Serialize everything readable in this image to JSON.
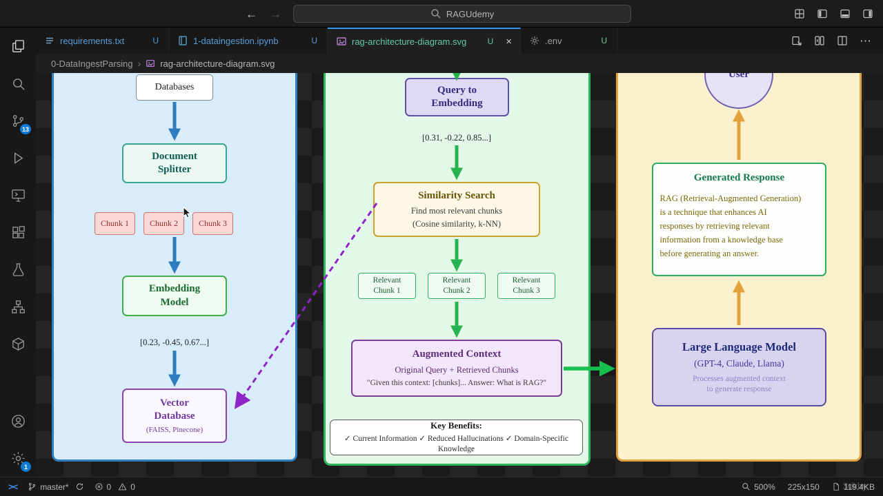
{
  "titlebar": {
    "search_text": "RAGUdemy"
  },
  "icons": {
    "back_arrow": "←",
    "forward_arrow": "→",
    "close": "×",
    "breadcrumb_chevron": "›",
    "more_actions": "⋯",
    "remote": "><"
  },
  "tabs": [
    {
      "label": "requirements.txt",
      "git": "U"
    },
    {
      "label": "1-dataingestion.ipynb",
      "git": "U"
    },
    {
      "label": "rag-architecture-diagram.svg",
      "git": "U"
    },
    {
      "label": ".env",
      "git": "U"
    }
  ],
  "breadcrumb": {
    "folder": "0-DataIngestParsing",
    "file": "rag-architecture-diagram.svg"
  },
  "activitybar": {
    "badges": {
      "source_control": "13",
      "settings": "1"
    }
  },
  "statusbar": {
    "branch": "master*",
    "errors": "0",
    "warnings": "0",
    "zoom": "500%",
    "dimensions": "225x150",
    "filesize": "119.4KB"
  },
  "watermark": "3dkby",
  "diagram": {
    "left": {
      "databases": "Databases",
      "splitter_1": "Document",
      "splitter_2": "Splitter",
      "chunks": [
        "Chunk 1",
        "Chunk 2",
        "Chunk 3"
      ],
      "embedding_1": "Embedding",
      "embedding_2": "Model",
      "vector": "[0.23, -0.45, 0.67...]",
      "vectordb_1": "Vector",
      "vectordb_2": "Database",
      "vectordb_3": "(FAISS, Pinecone)"
    },
    "middle": {
      "query_1": "Query to",
      "query_2": "Embedding",
      "vector": "[0.31, -0.22, 0.85...]",
      "sim_title": "Similarity Search",
      "sim_line1": "Find most relevant chunks",
      "sim_line2": "(Cosine similarity, k-NN)",
      "rel_chunks": [
        {
          "l1": "Relevant",
          "l2": "Chunk 1"
        },
        {
          "l1": "Relevant",
          "l2": "Chunk 2"
        },
        {
          "l1": "Relevant",
          "l2": "Chunk 3"
        }
      ],
      "aug_title": "Augmented Context",
      "aug_line1": "Original Query + Retrieved Chunks",
      "aug_line2": "\"Given this context: [chunks]... Answer: What is RAG?\"",
      "ben_title": "Key Benefits:",
      "ben_line": "✓ Current Information ✓ Reduced Hallucinations ✓ Domain-Specific Knowledge"
    },
    "right": {
      "user": "User",
      "gen_title": "Generated Response",
      "gen_lines": [
        "RAG (Retrieval-Augmented Generation)",
        "is a technique that enhances AI",
        "responses by retrieving relevant",
        "information from a knowledge base",
        "before generating an answer."
      ],
      "llm_title": "Large Language Model",
      "llm_line1": "(GPT-4, Claude, Llama)",
      "llm_line2": "Processes augmented context",
      "llm_line3": "to generate response"
    }
  },
  "colors": {
    "accent_blue": "#3b9eff",
    "badge_blue": "#0d7ad6",
    "tab_blue": "#569cd6",
    "tab_green": "#62c9a2",
    "untracked_green": "#73c991",
    "panel_left_border": "#2f7fc1",
    "panel_mid_border": "#2eb85c",
    "panel_right_border": "#e2a33e",
    "arrow_blue": "#2e7cc0",
    "arrow_green": "#29b34e",
    "arrow_orange": "#e3a23a",
    "arrow_purple": "#8f24c7"
  }
}
